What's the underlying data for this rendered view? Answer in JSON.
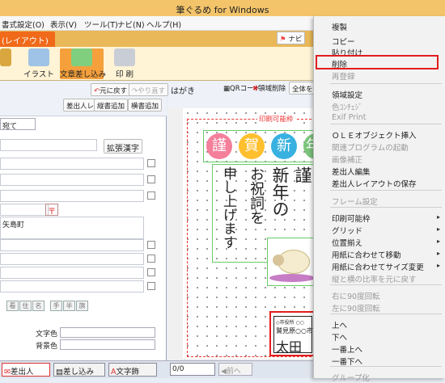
{
  "window": {
    "title": "筆ぐるめ for Windows"
  },
  "menubar": {
    "items": [
      "書式設定(O)",
      "表示(V)",
      "ツール(T)",
      "ナビ(N)",
      "ヘルプ(H)"
    ]
  },
  "ribbon": {
    "active_tab": "(レイアウト)",
    "navi_label": "ナビ",
    "buttons": [
      {
        "label": "",
        "icon": "frame-icon"
      },
      {
        "label": "イラスト",
        "icon": "illustration-icon"
      },
      {
        "label": "文章差し込み",
        "icon": "insert-text-icon"
      },
      {
        "label": "印 刷",
        "icon": "printer-icon"
      }
    ]
  },
  "toolbar": {
    "undo_label": "元に戻す",
    "redo_label": "やり直す",
    "card_label": "はがき",
    "qr_label": "QRコード",
    "delete_label": "領域削除",
    "view_label": "全体を"
  },
  "leftpanel": {
    "buttons": [
      "差出人レイアウト",
      "縦書追加",
      "横書追加"
    ],
    "tab_label": "宛て",
    "kanji_button": "拡張漢字",
    "postal_icon": "〒",
    "address_text": "矢島町",
    "mini_buttons": [
      "看",
      "住",
      "名",
      "手",
      "半",
      "旗"
    ],
    "text_color_label": "文字色",
    "bg_color_label": "背景色"
  },
  "canvas": {
    "printable_label": "印刷可能枠",
    "circle_chars": [
      "謹",
      "賀",
      "新",
      "年"
    ],
    "greeting_cols": [
      "謹",
      "新年の",
      "お祝詞を",
      "申し上げます"
    ],
    "stamp_top": "◇市役所 ○○",
    "stamp_mid": "鷲見原○○市",
    "stamp_name": "太田"
  },
  "bottombar": {
    "tabs": [
      "差出人",
      "差し込み",
      "文字飾",
      "0/0",
      "前へ"
    ]
  },
  "context_menu": {
    "items": [
      {
        "label": "複製",
        "disabled": false
      },
      {
        "label": "コピー",
        "disabled": false
      },
      {
        "label": "貼り付け",
        "disabled": false
      },
      {
        "label": "削除",
        "disabled": false,
        "highlighted": true
      },
      {
        "label": "再登録",
        "disabled": true
      },
      {
        "label": "領域設定",
        "disabled": false
      },
      {
        "label": "色ｺﾝﾁｪｼﾞ",
        "disabled": true
      },
      {
        "label": "Exif Print",
        "disabled": true
      },
      {
        "label": "ＯＬＥオブジェクト挿入",
        "disabled": false
      },
      {
        "label": "関連プログラムの起動",
        "disabled": true
      },
      {
        "label": "画像補正",
        "disabled": true
      },
      {
        "label": "差出人編集",
        "disabled": false
      },
      {
        "label": "差出人レイアウトの保存",
        "disabled": false
      },
      {
        "label": "フレーム設定",
        "disabled": true
      },
      {
        "label": "印刷可能枠",
        "disabled": false,
        "submenu": true
      },
      {
        "label": "グリッド",
        "disabled": false,
        "submenu": true
      },
      {
        "label": "位置揃え",
        "disabled": false,
        "submenu": true
      },
      {
        "label": "用紙に合わせて移動",
        "disabled": false,
        "submenu": true
      },
      {
        "label": "用紙に合わせてサイズ変更",
        "disabled": false,
        "submenu": true
      },
      {
        "label": "縦と横の比率を元に戻す",
        "disabled": true
      },
      {
        "label": "右に90度回転",
        "disabled": true
      },
      {
        "label": "左に90度回転",
        "disabled": true
      },
      {
        "label": "上へ",
        "disabled": false
      },
      {
        "label": "下へ",
        "disabled": false
      },
      {
        "label": "一番上へ",
        "disabled": false
      },
      {
        "label": "一番下へ",
        "disabled": false
      },
      {
        "label": "グループ化",
        "disabled": true
      }
    ]
  },
  "colors": {
    "accent": "#f06a1a",
    "highlight": "#e31c1c",
    "title": "#f3c46a"
  }
}
